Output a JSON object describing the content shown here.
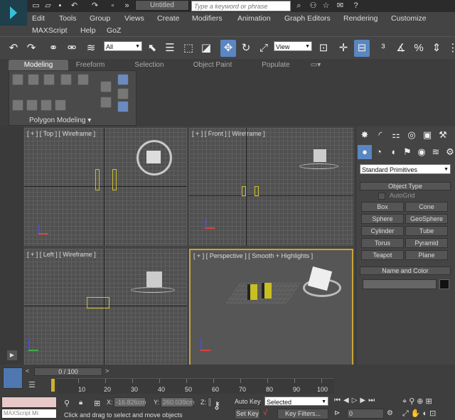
{
  "app": {
    "title": "Untitled",
    "search_placeholder": "Type a keyword or phrase"
  },
  "menu": {
    "items": [
      "Edit",
      "Tools",
      "Group",
      "Views",
      "Create",
      "Modifiers",
      "Animation",
      "Graph Editors",
      "Rendering",
      "Customize",
      "MAXScript",
      "Help",
      "GoZ"
    ]
  },
  "toolbar": {
    "selection_filter": "All",
    "refcoord": "View"
  },
  "ribbon": {
    "tabs": [
      "Modeling",
      "Freeform",
      "Selection",
      "Object Paint",
      "Populate"
    ],
    "panel_label": "Polygon Modeling"
  },
  "viewports": {
    "top": "[ + ] [ Top ] [ Wireframe ]",
    "front": "[ + ] [ Front ] [ Wireframe ]",
    "left": "[ + ] [ Left ] [ Wireframe ]",
    "persp": "[ + ] [ Perspective ] [ Smooth + Highlights ]"
  },
  "command_panel": {
    "dropdown": "Standard Primitives",
    "object_type": "Object Type",
    "autogrid": "AutoGrid",
    "buttons": [
      "Box",
      "Cone",
      "Sphere",
      "GeoSphere",
      "Cylinder",
      "Tube",
      "Torus",
      "Pyramid",
      "Teapot",
      "Plane"
    ],
    "name_color": "Name and Color"
  },
  "timeline": {
    "frame": "0 / 100",
    "ticks": [
      "10",
      "20",
      "30",
      "40",
      "50",
      "60",
      "70",
      "80",
      "90",
      "100"
    ]
  },
  "status": {
    "x_label": "X:",
    "x_value": "-16.826cm",
    "y_label": "Y:",
    "y_value": "260.039cm",
    "z_label": "Z:",
    "autokey": "Auto Key",
    "selected": "Selected",
    "setkey": "Set Key",
    "keyfilters": "Key Filters...",
    "hint": "Click and drag to select and move objects",
    "maxscript": "MAXScript Mi:",
    "frame_field": "0"
  }
}
